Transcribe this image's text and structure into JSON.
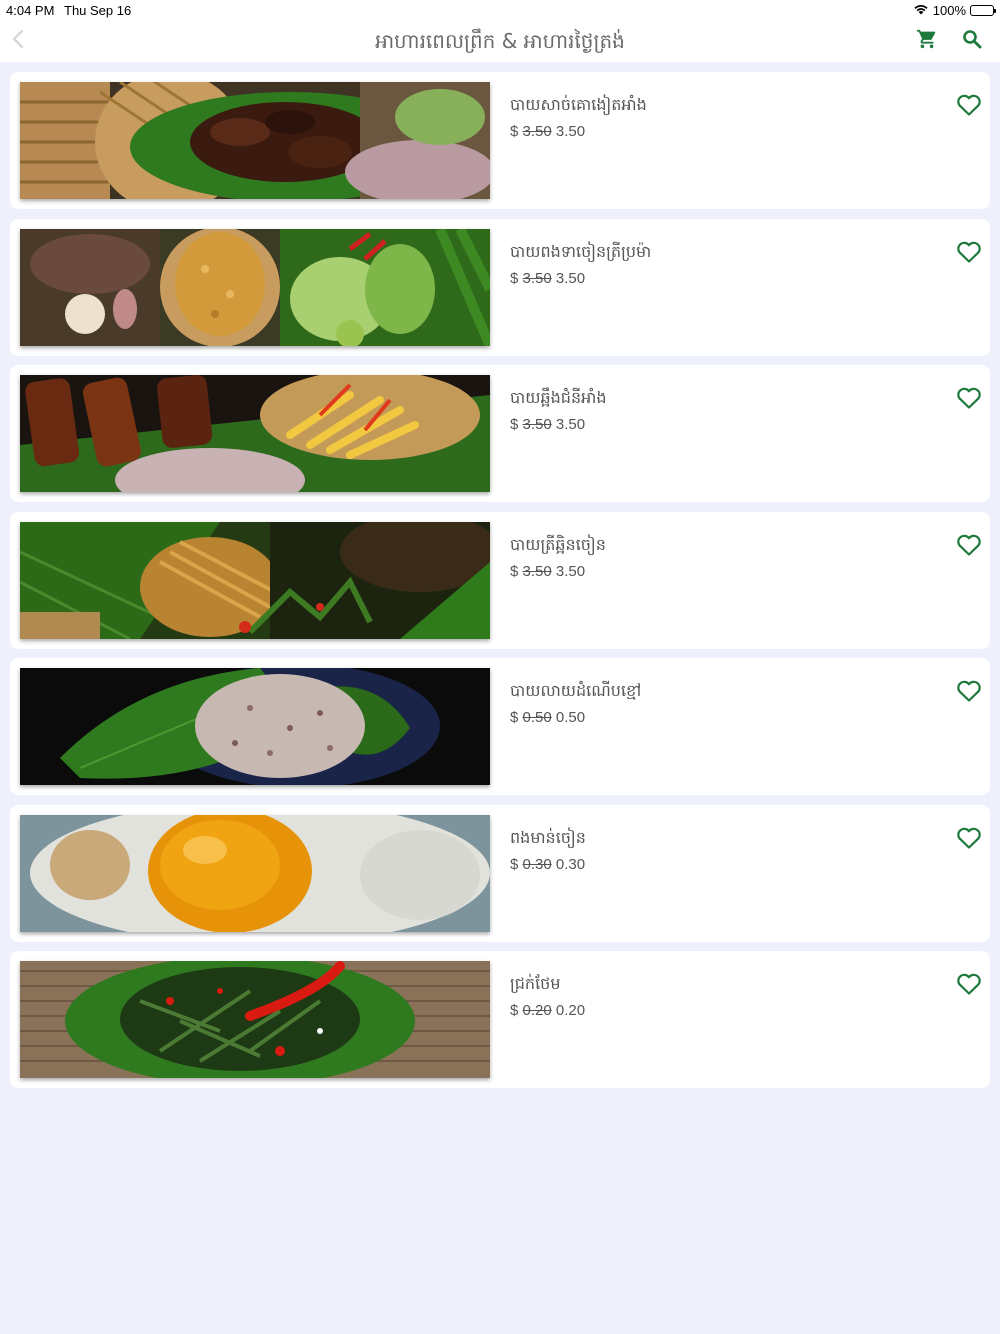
{
  "status_bar": {
    "time": "4:04 PM",
    "date": "Thu Sep 16",
    "battery": "100%",
    "wifi_icon": "wifi-icon",
    "battery_icon": "battery-icon"
  },
  "header": {
    "title": "អាហារពេលព្រឹក & អាហារថ្ងៃត្រង់",
    "back_icon": "chevron-left-icon",
    "cart_icon": "cart-icon",
    "search_icon": "search-icon"
  },
  "colors": {
    "accent": "#1e7a3c",
    "background": "#eef0fb",
    "card": "#ffffff"
  },
  "items": [
    {
      "name": "បាយសាច់គោងៀតអាំង",
      "currency": "$",
      "old_price": "3.50",
      "price": "3.50",
      "image": "grilled-dried-beef-with-rice",
      "favorite_icon": "heart-outline-icon"
    },
    {
      "name": "បាយពងទាចៀនត្រីប្រម៉ា",
      "currency": "$",
      "old_price": "3.50",
      "price": "3.50",
      "image": "salted-fish-omelette-with-vegetables",
      "favorite_icon": "heart-outline-icon"
    },
    {
      "name": "បាយឆ្អឹងជំនីអាំង",
      "currency": "$",
      "old_price": "3.50",
      "price": "3.50",
      "image": "grilled-pork-ribs-with-pickles",
      "favorite_icon": "heart-outline-icon"
    },
    {
      "name": "បាយត្រីឆ្អិនចៀន",
      "currency": "$",
      "old_price": "3.50",
      "price": "3.50",
      "image": "fried-fish-with-greens",
      "favorite_icon": "heart-outline-icon"
    },
    {
      "name": "បាយលាយដំណើបខ្មៅ",
      "currency": "$",
      "old_price": "0.50",
      "price": "0.50",
      "image": "mixed-black-sticky-rice",
      "favorite_icon": "heart-outline-icon"
    },
    {
      "name": "ពងមាន់ចៀន",
      "currency": "$",
      "old_price": "0.30",
      "price": "0.30",
      "image": "fried-egg",
      "favorite_icon": "heart-outline-icon"
    },
    {
      "name": "ជ្រក់ថែម",
      "currency": "$",
      "old_price": "0.20",
      "price": "0.20",
      "image": "pickled-greens-with-chili",
      "favorite_icon": "heart-outline-icon"
    }
  ]
}
